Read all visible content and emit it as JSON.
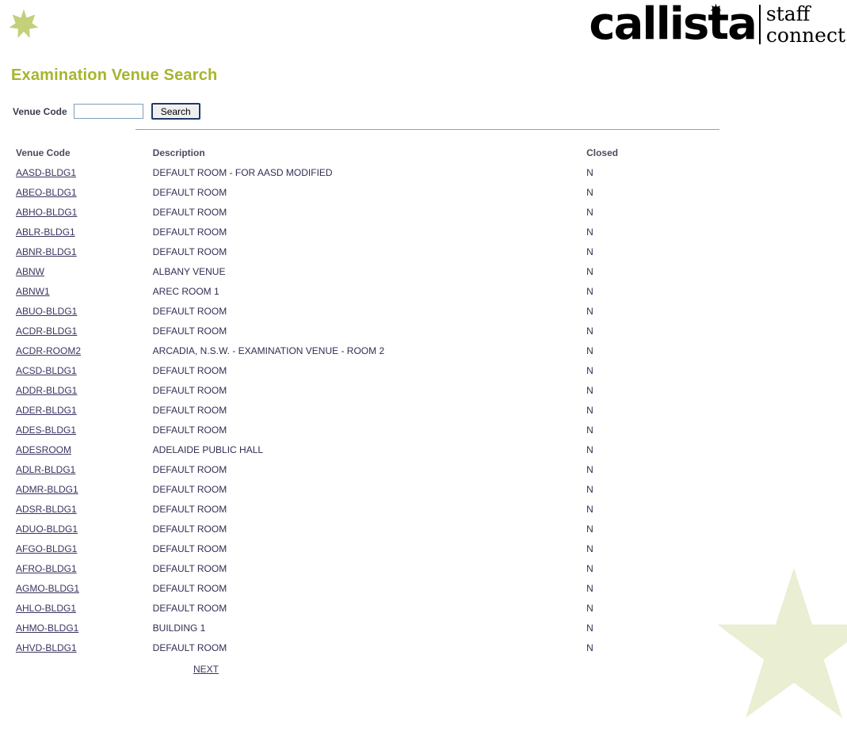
{
  "brand": {
    "mark_icon": "six-point-star-icon",
    "logo_word": "callista",
    "logo_line1": "staff",
    "logo_line2": "connect",
    "logo_star_icon": "six-point-star-icon",
    "accent_color": "#a7b52c",
    "star_fill": "#c4d07a",
    "watermark_fill": "#eaeed2"
  },
  "page": {
    "title": "Examination Venue Search"
  },
  "search": {
    "label": "Venue Code",
    "value": "",
    "placeholder": "",
    "button_label": "Search"
  },
  "table": {
    "headers": {
      "code": "Venue Code",
      "description": "Description",
      "closed": "Closed"
    },
    "rows": [
      {
        "code": "AASD-BLDG1",
        "description": "DEFAULT ROOM - FOR AASD MODIFIED",
        "closed": "N"
      },
      {
        "code": "ABEO-BLDG1",
        "description": "DEFAULT ROOM",
        "closed": "N"
      },
      {
        "code": "ABHO-BLDG1",
        "description": "DEFAULT ROOM",
        "closed": "N"
      },
      {
        "code": "ABLR-BLDG1",
        "description": "DEFAULT ROOM",
        "closed": "N"
      },
      {
        "code": "ABNR-BLDG1",
        "description": "DEFAULT ROOM",
        "closed": "N"
      },
      {
        "code": "ABNW",
        "description": "ALBANY VENUE",
        "closed": "N"
      },
      {
        "code": "ABNW1",
        "description": "AREC ROOM 1",
        "closed": "N"
      },
      {
        "code": "ABUO-BLDG1",
        "description": "DEFAULT ROOM",
        "closed": "N"
      },
      {
        "code": "ACDR-BLDG1",
        "description": "DEFAULT ROOM",
        "closed": "N"
      },
      {
        "code": "ACDR-ROOM2",
        "description": "ARCADIA, N.S.W. - EXAMINATION VENUE - ROOM 2",
        "closed": "N"
      },
      {
        "code": "ACSD-BLDG1",
        "description": "DEFAULT ROOM",
        "closed": "N"
      },
      {
        "code": "ADDR-BLDG1",
        "description": "DEFAULT ROOM",
        "closed": "N"
      },
      {
        "code": "ADER-BLDG1",
        "description": "DEFAULT ROOM",
        "closed": "N"
      },
      {
        "code": "ADES-BLDG1",
        "description": "DEFAULT ROOM",
        "closed": "N"
      },
      {
        "code": "ADESROOM",
        "description": "ADELAIDE PUBLIC HALL",
        "closed": "N"
      },
      {
        "code": "ADLR-BLDG1",
        "description": "DEFAULT ROOM",
        "closed": "N"
      },
      {
        "code": "ADMR-BLDG1",
        "description": "DEFAULT ROOM",
        "closed": "N"
      },
      {
        "code": "ADSR-BLDG1",
        "description": "DEFAULT ROOM",
        "closed": "N"
      },
      {
        "code": "ADUO-BLDG1",
        "description": "DEFAULT ROOM",
        "closed": "N"
      },
      {
        "code": "AFGO-BLDG1",
        "description": "DEFAULT ROOM",
        "closed": "N"
      },
      {
        "code": "AFRO-BLDG1",
        "description": "DEFAULT ROOM",
        "closed": "N"
      },
      {
        "code": "AGMO-BLDG1",
        "description": "DEFAULT ROOM",
        "closed": "N"
      },
      {
        "code": "AHLO-BLDG1",
        "description": "DEFAULT ROOM",
        "closed": "N"
      },
      {
        "code": "AHMO-BLDG1",
        "description": "BUILDING 1",
        "closed": "N"
      },
      {
        "code": "AHVD-BLDG1",
        "description": "DEFAULT ROOM",
        "closed": "N"
      }
    ]
  },
  "pagination": {
    "next_label": "NEXT"
  }
}
